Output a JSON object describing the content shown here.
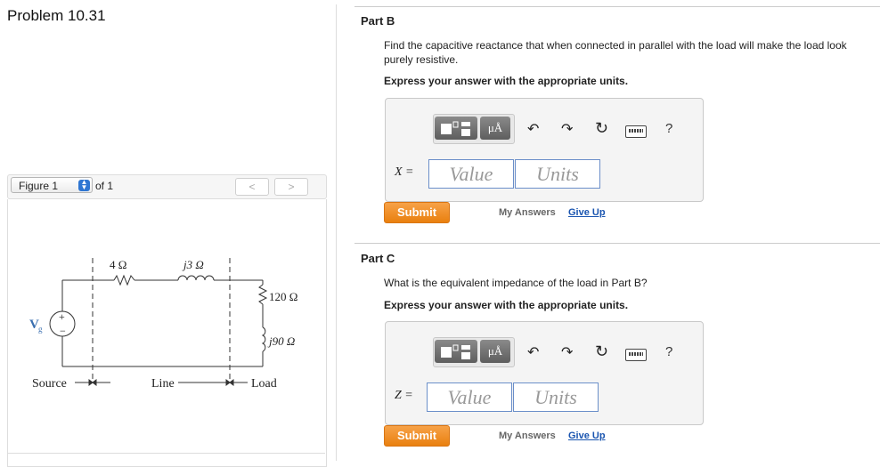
{
  "problem": {
    "title": "Problem 10.31"
  },
  "figure": {
    "selector_value": "Figure 1",
    "of_text": "of 1",
    "prev": "<",
    "next": ">",
    "circuit": {
      "r_line": "4 Ω",
      "x_line": "j3 Ω",
      "r_load": "120 Ω",
      "x_load": "j90 Ω",
      "source_v": "V",
      "source_sub": "g",
      "plus": "+",
      "minus": "−",
      "source_label": "Source",
      "line_label": "Line",
      "load_label": "Load"
    }
  },
  "toolbar": {
    "units_btn": "μÅ",
    "help": "?"
  },
  "partB": {
    "title": "Part B",
    "question": "Find the capacitive reactance that when connected in parallel with the load will make the load look purely resistive.",
    "instruction": "Express your answer with the appropriate units.",
    "var_label": "X =",
    "value_placeholder": "Value",
    "units_placeholder": "Units",
    "submit": "Submit",
    "my_answers": "My Answers",
    "give_up": "Give Up"
  },
  "partC": {
    "title": "Part C",
    "question": "What is the equivalent impedance of the load in Part B?",
    "instruction": "Express your answer with the appropriate units.",
    "var_label": "Z =",
    "value_placeholder": "Value",
    "units_placeholder": "Units",
    "submit": "Submit",
    "my_answers": "My Answers",
    "give_up": "Give Up"
  }
}
